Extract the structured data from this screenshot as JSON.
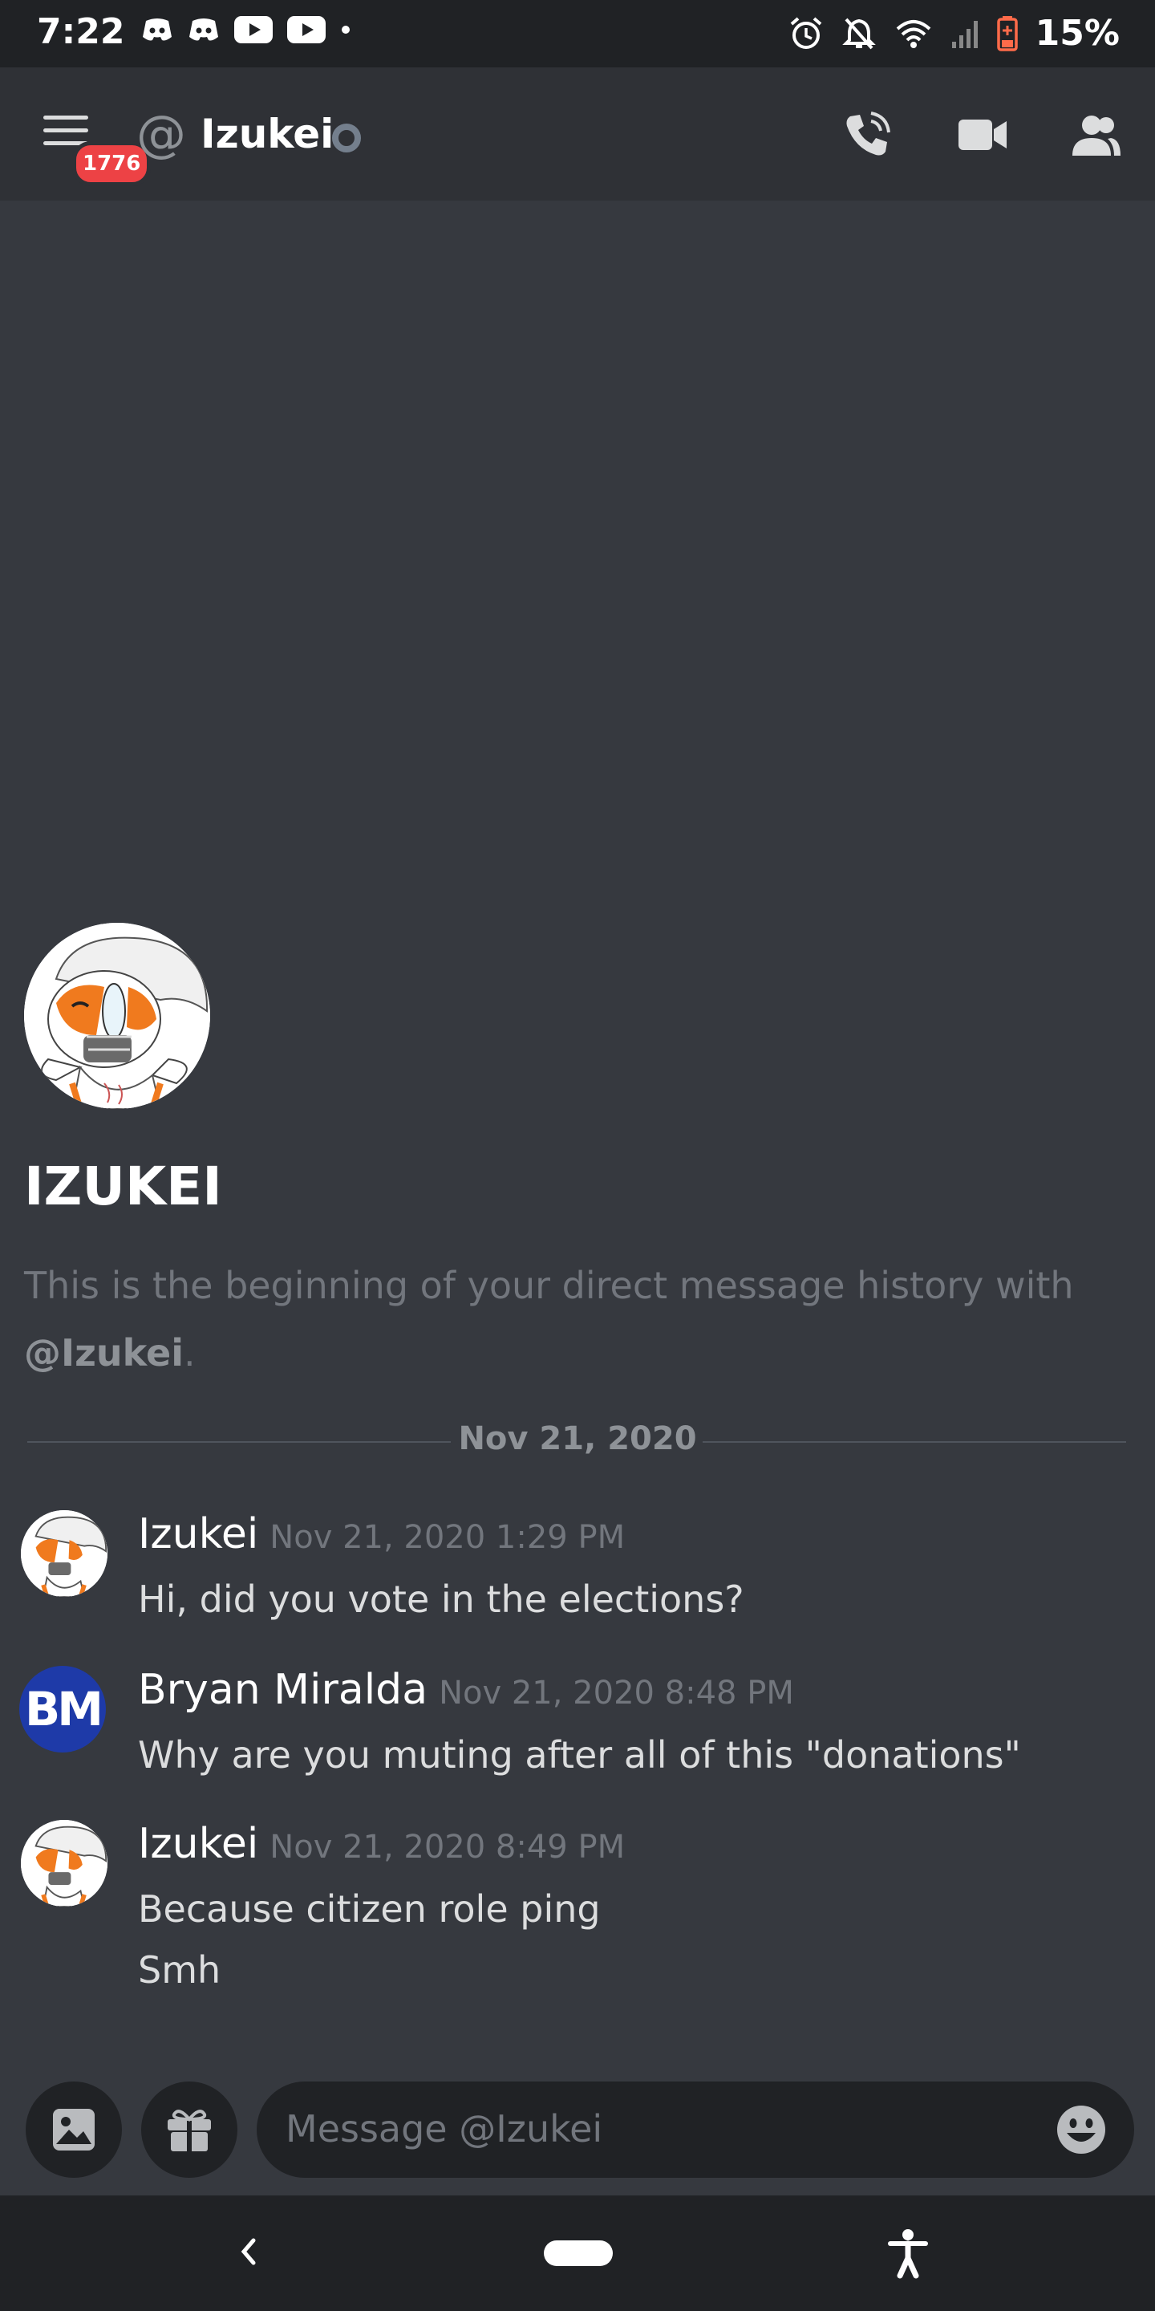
{
  "status_bar": {
    "time": "7:22",
    "battery": "15%"
  },
  "header": {
    "notification_badge": "1776",
    "at_symbol": "@",
    "title": "Izukei"
  },
  "welcome": {
    "name": "IZUKEI",
    "text_prefix": "This is the beginning of your direct message history with",
    "mention": "@Izukei",
    "text_suffix": "."
  },
  "divider": {
    "label": "Nov 21, 2020"
  },
  "messages": [
    {
      "author": "Izukei",
      "timestamp": "Nov 21, 2020 1:29 PM",
      "lines": [
        "Hi, did you vote in the elections?"
      ]
    },
    {
      "author": "Bryan Miralda",
      "avatar_initials": "BM",
      "timestamp": "Nov 21, 2020 8:48 PM",
      "lines": [
        "Why are you muting after all of this \"donations\""
      ]
    },
    {
      "author": "Izukei",
      "timestamp": "Nov 21, 2020 8:49 PM",
      "lines": [
        "Because citizen role ping",
        "Smh"
      ]
    }
  ],
  "composer": {
    "placeholder": "Message @Izukei"
  },
  "colors": {
    "background": "#36393f",
    "header": "#2f3136",
    "status_bar": "#202225",
    "badge": "#ed4245",
    "muted_text": "#72767d"
  },
  "icons": {
    "status_left": [
      "discord-icon",
      "discord-icon",
      "youtube-icon",
      "youtube-icon",
      "dot-icon"
    ],
    "status_right": [
      "alarm-icon",
      "bell-off-icon",
      "wifi-icon",
      "signal-icon",
      "battery-icon"
    ],
    "header_right": [
      "phone-call-icon",
      "video-camera-icon",
      "members-icon"
    ],
    "composer": [
      "image-icon",
      "gift-icon",
      "emoji-icon"
    ],
    "nav": [
      "back-icon",
      "home-pill",
      "accessibility-icon"
    ]
  }
}
